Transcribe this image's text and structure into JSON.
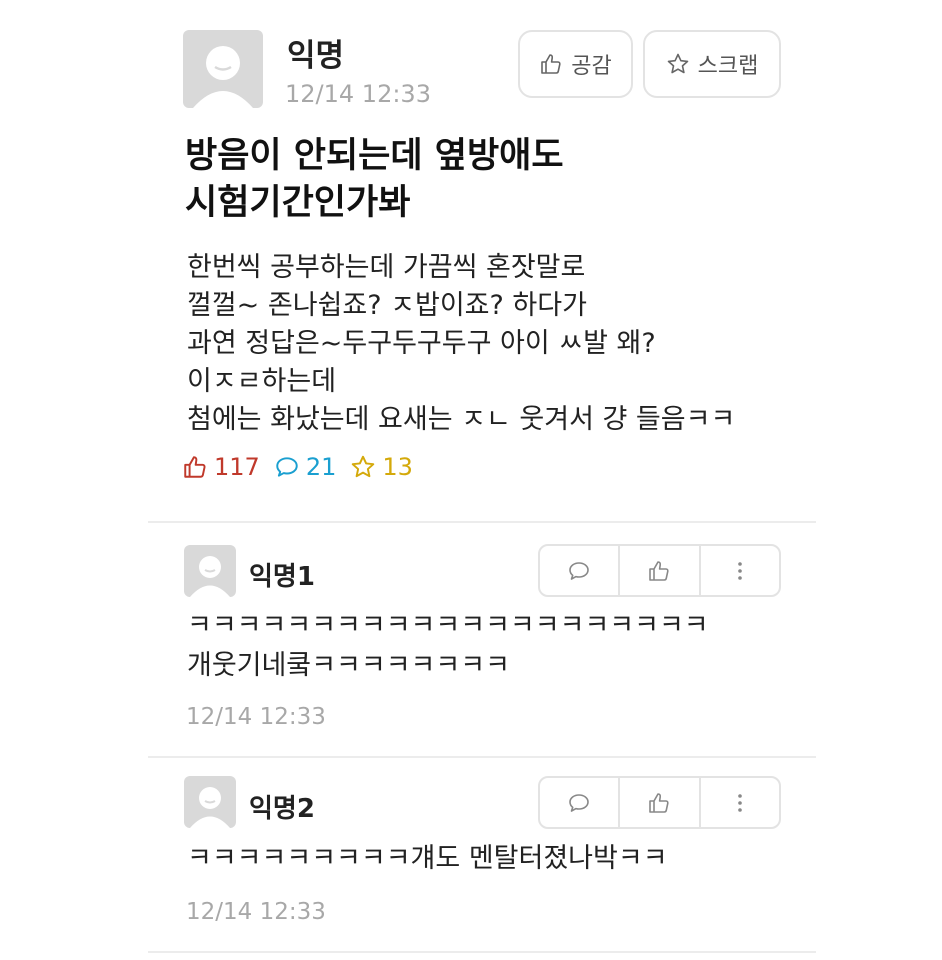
{
  "post": {
    "author": "익명",
    "time": "12/14 12:33",
    "like_button": "공감",
    "scrap_button": "스크랩",
    "title": "방음이 안되는데 옆방애도\n시험기간인가봐",
    "body": "한번씩 공부하는데 가끔씩 혼잣말로\n껄껄~ 존나쉽죠? ㅈ밥이죠? 하다가\n과연 정답은~두구두구두구 아이 ㅆ발 왜?\n이ㅈㄹ하는데\n첨에는 화났는데 요새는 ㅈㄴ 웃겨서 걍 들음ㅋㅋ",
    "stats": {
      "likes": "117",
      "comments": "21",
      "scraps": "13"
    }
  },
  "comments": [
    {
      "author": "익명1",
      "text": "ㅋㅋㅋㅋㅋㅋㅋㅋㅋㅋㅋㅋㅋㅋㅋㅋㅋㅋㅋㅋㅋ\n개웃기네쿸ㅋㅋㅋㅋㅋㅋㅋㅋ",
      "time": "12/14 12:33"
    },
    {
      "author": "익명2",
      "text": "ㅋㅋㅋㅋㅋㅋㅋㅋㅋ걔도 멘탈터졌나박ㅋㅋ",
      "time": "12/14 12:33"
    }
  ],
  "colors": {
    "like": "#c0392b",
    "comment": "#1a9fd0",
    "scrap": "#d4a90a",
    "muted": "#a8a8a8",
    "border": "#e3e3e3"
  }
}
